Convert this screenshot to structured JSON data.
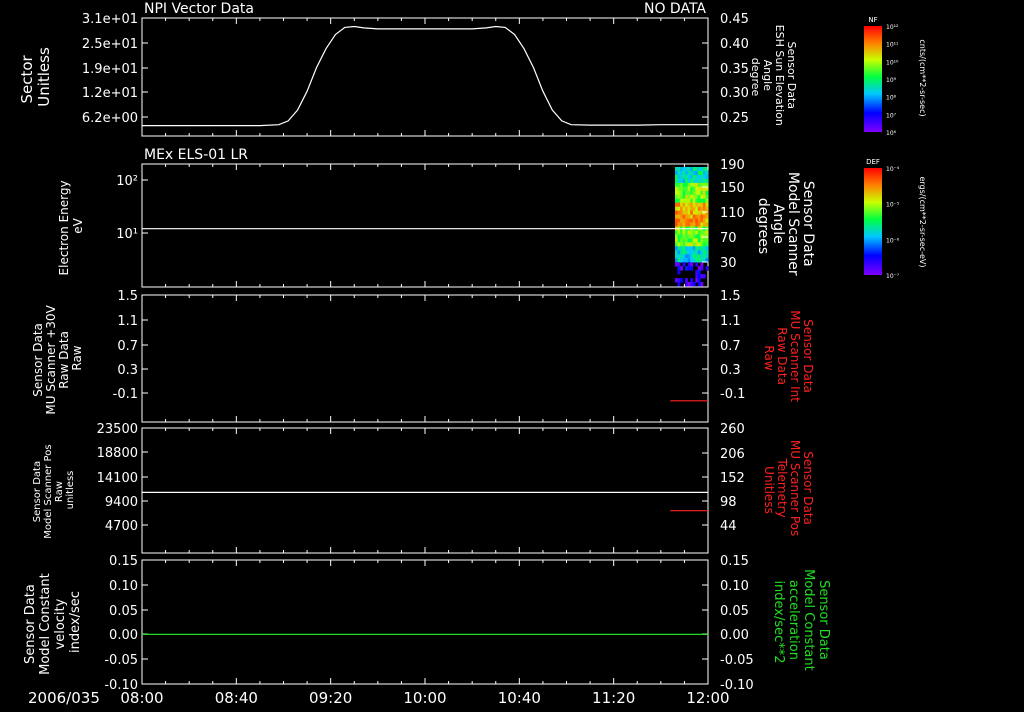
{
  "date_label": "2006/035",
  "x_axis": {
    "start_min": 0,
    "end_min": 240,
    "ticks": [
      {
        "t": 0,
        "label": "08:00"
      },
      {
        "t": 40,
        "label": "08:40"
      },
      {
        "t": 80,
        "label": "09:20"
      },
      {
        "t": 120,
        "label": "10:00"
      },
      {
        "t": 160,
        "label": "10:40"
      },
      {
        "t": 200,
        "label": "11:20"
      },
      {
        "t": 240,
        "label": "12:00"
      }
    ]
  },
  "colors": {
    "axis": "#ffffff",
    "red_series": "#ff2020",
    "green_series": "#22dd22"
  },
  "colorbars": [
    {
      "label": "NF",
      "unit": "cnts/(cm**2-sr-sec)",
      "ticks": [
        "10¹²",
        "10¹¹",
        "10¹⁰",
        "10⁹",
        "10⁸",
        "10⁷",
        "10⁶"
      ]
    },
    {
      "label": "DEF",
      "unit": "ergs/(cm**2-sr-sec-eV)",
      "ticks": [
        "10⁻⁴",
        "10⁻⁵",
        "10⁻⁶",
        "10⁻⁷"
      ]
    }
  ],
  "chart_data": [
    {
      "type": "line",
      "title": "NPI Vector Data",
      "title_right": "NO DATA",
      "ylabel_left": [
        "Sector",
        "Unitless"
      ],
      "left_ticks": [
        "3.1e+01",
        "2.5e+01",
        "1.9e+01",
        "1.2e+01",
        "6.2e+00"
      ],
      "ylabel_right": [
        "Sensor Data",
        "ESH Sun Elevation",
        "Angle",
        "degree"
      ],
      "right_ticks": [
        "0.45",
        "0.40",
        "0.35",
        "0.30",
        "0.25"
      ],
      "yright_lim": [
        0.2,
        0.45
      ],
      "series": [
        {
          "axis": "right",
          "color": "#ffffff",
          "x": [
            0,
            10,
            20,
            30,
            40,
            50,
            58,
            62,
            66,
            70,
            74,
            78,
            82,
            86,
            90,
            94,
            100,
            110,
            120,
            130,
            140,
            146,
            150,
            154,
            158,
            162,
            166,
            170,
            174,
            178,
            182,
            190,
            200,
            210,
            220,
            230,
            240
          ],
          "y": [
            0.222,
            0.222,
            0.222,
            0.222,
            0.222,
            0.222,
            0.224,
            0.232,
            0.255,
            0.295,
            0.345,
            0.385,
            0.415,
            0.43,
            0.432,
            0.429,
            0.427,
            0.427,
            0.427,
            0.427,
            0.427,
            0.429,
            0.432,
            0.43,
            0.415,
            0.385,
            0.345,
            0.295,
            0.255,
            0.232,
            0.224,
            0.223,
            0.223,
            0.223,
            0.224,
            0.224,
            0.224
          ]
        }
      ]
    },
    {
      "type": "heatmap",
      "title": "MEx ELS-01 LR",
      "ylabel_left": [
        "Electron Energy",
        "eV"
      ],
      "left_ticks": [
        "10²",
        "10¹"
      ],
      "ylabel_right": [
        "Sensor Data",
        "Model Scanner",
        "Angle",
        "degrees"
      ],
      "right_ticks": [
        "190",
        "150",
        "110",
        "70",
        "30"
      ],
      "yright_lim": [
        0,
        190
      ],
      "spectrogram_x_range": [
        226,
        240
      ],
      "spectrogram_energy_range_log10": [
        0.3,
        2.1
      ],
      "series": [
        {
          "axis": "right",
          "color": "#ffffff",
          "x": [
            0,
            240
          ],
          "y": [
            90,
            90
          ]
        }
      ]
    },
    {
      "type": "line",
      "ylabel_left": [
        "Sensor Data",
        "MU Scanner +30V",
        "Raw Data",
        "Raw"
      ],
      "left_ticks": [
        "1.5",
        "1.1",
        "0.7",
        "0.3",
        "-0.1"
      ],
      "ylabel_right": [
        "Sensor Data",
        "MU Scanner Int",
        "Raw Data",
        "Raw"
      ],
      "ylabel_right_color": "#ff2020",
      "right_ticks": [
        "1.5",
        "1.1",
        "0.7",
        "0.3",
        "-0.1"
      ],
      "yright_lim": [
        -0.3,
        1.5
      ],
      "series": [
        {
          "axis": "right",
          "color": "#ff2020",
          "x": [
            224,
            240
          ],
          "y": [
            0.0,
            0.0
          ]
        }
      ]
    },
    {
      "type": "line",
      "ylabel_left": [
        "Sensor Data",
        "Model Scanner Pos",
        "Raw",
        "unitless"
      ],
      "left_ticks": [
        "23500",
        "18800",
        "14100",
        "9400",
        "4700"
      ],
      "ylabel_right": [
        "Sensor Data",
        "MU Scanner Pos",
        "Telemetry",
        "Unitless"
      ],
      "ylabel_right_color": "#ff2020",
      "right_ticks": [
        "260",
        "206",
        "152",
        "98",
        "44"
      ],
      "yleft_lim": [
        0,
        23500
      ],
      "yright_lim": [
        0,
        260
      ],
      "series": [
        {
          "axis": "left",
          "color": "#ffffff",
          "x": [
            0,
            240
          ],
          "y": [
            11400,
            11400
          ]
        },
        {
          "axis": "right",
          "color": "#ff2020",
          "x": [
            224,
            240
          ],
          "y": [
            88,
            88
          ]
        }
      ]
    },
    {
      "type": "line",
      "ylabel_left": [
        "Sensor Data",
        "Model Constant",
        "velocity",
        "index/sec"
      ],
      "left_ticks": [
        "0.15",
        "0.10",
        "0.05",
        "0.00",
        "-0.05",
        "-0.10"
      ],
      "ylabel_right": [
        "Sensor Data",
        "Model Constant",
        "acceleration",
        "index/sec**2"
      ],
      "ylabel_right_color": "#22dd22",
      "right_ticks": [
        "0.15",
        "0.10",
        "0.05",
        "0.00",
        "-0.05",
        "-0.10"
      ],
      "yright_lim": [
        -0.1,
        0.15
      ],
      "series": [
        {
          "axis": "right",
          "color": "#22dd22",
          "x": [
            0,
            240
          ],
          "y": [
            0.0,
            0.0
          ]
        }
      ]
    }
  ]
}
